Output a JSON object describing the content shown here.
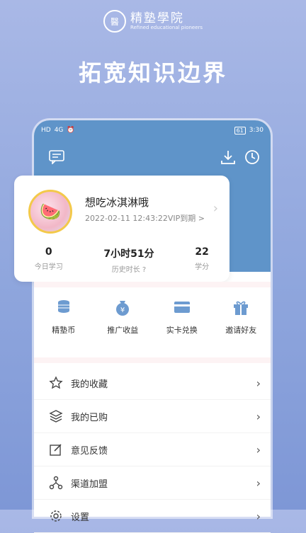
{
  "brand": {
    "logo": "醫",
    "name_cn": "精塾學院",
    "name_en": "Refined educational pioneers"
  },
  "headline": "拓宽知识边界",
  "status": {
    "left": [
      "HD",
      "4G",
      "⏰"
    ],
    "battery": "61",
    "time": "3:30"
  },
  "profile": {
    "username": "想吃冰淇淋哦",
    "vip": "2022-02-11 12:43:22VIP到期 >"
  },
  "stats": [
    {
      "value": "0",
      "label": "今日学习"
    },
    {
      "value": "7小时51分",
      "label": "历史时长 ?"
    },
    {
      "value": "22",
      "label": "学分"
    }
  ],
  "quick": [
    {
      "label": "精塾币",
      "icon": "coins-icon"
    },
    {
      "label": "推广收益",
      "icon": "money-bag-icon"
    },
    {
      "label": "实卡兑换",
      "icon": "card-icon"
    },
    {
      "label": "邀请好友",
      "icon": "gift-icon"
    }
  ],
  "menu": [
    {
      "label": "我的收藏",
      "icon": "star-icon"
    },
    {
      "label": "我的已购",
      "icon": "layers-icon"
    },
    {
      "label": "意见反馈",
      "icon": "feedback-icon"
    },
    {
      "label": "渠道加盟",
      "icon": "network-icon"
    },
    {
      "label": "设置",
      "icon": "settings-icon"
    }
  ],
  "colors": {
    "header": "#5f94c9",
    "accent": "#6d9bd0",
    "background": "#9cb0e2"
  }
}
